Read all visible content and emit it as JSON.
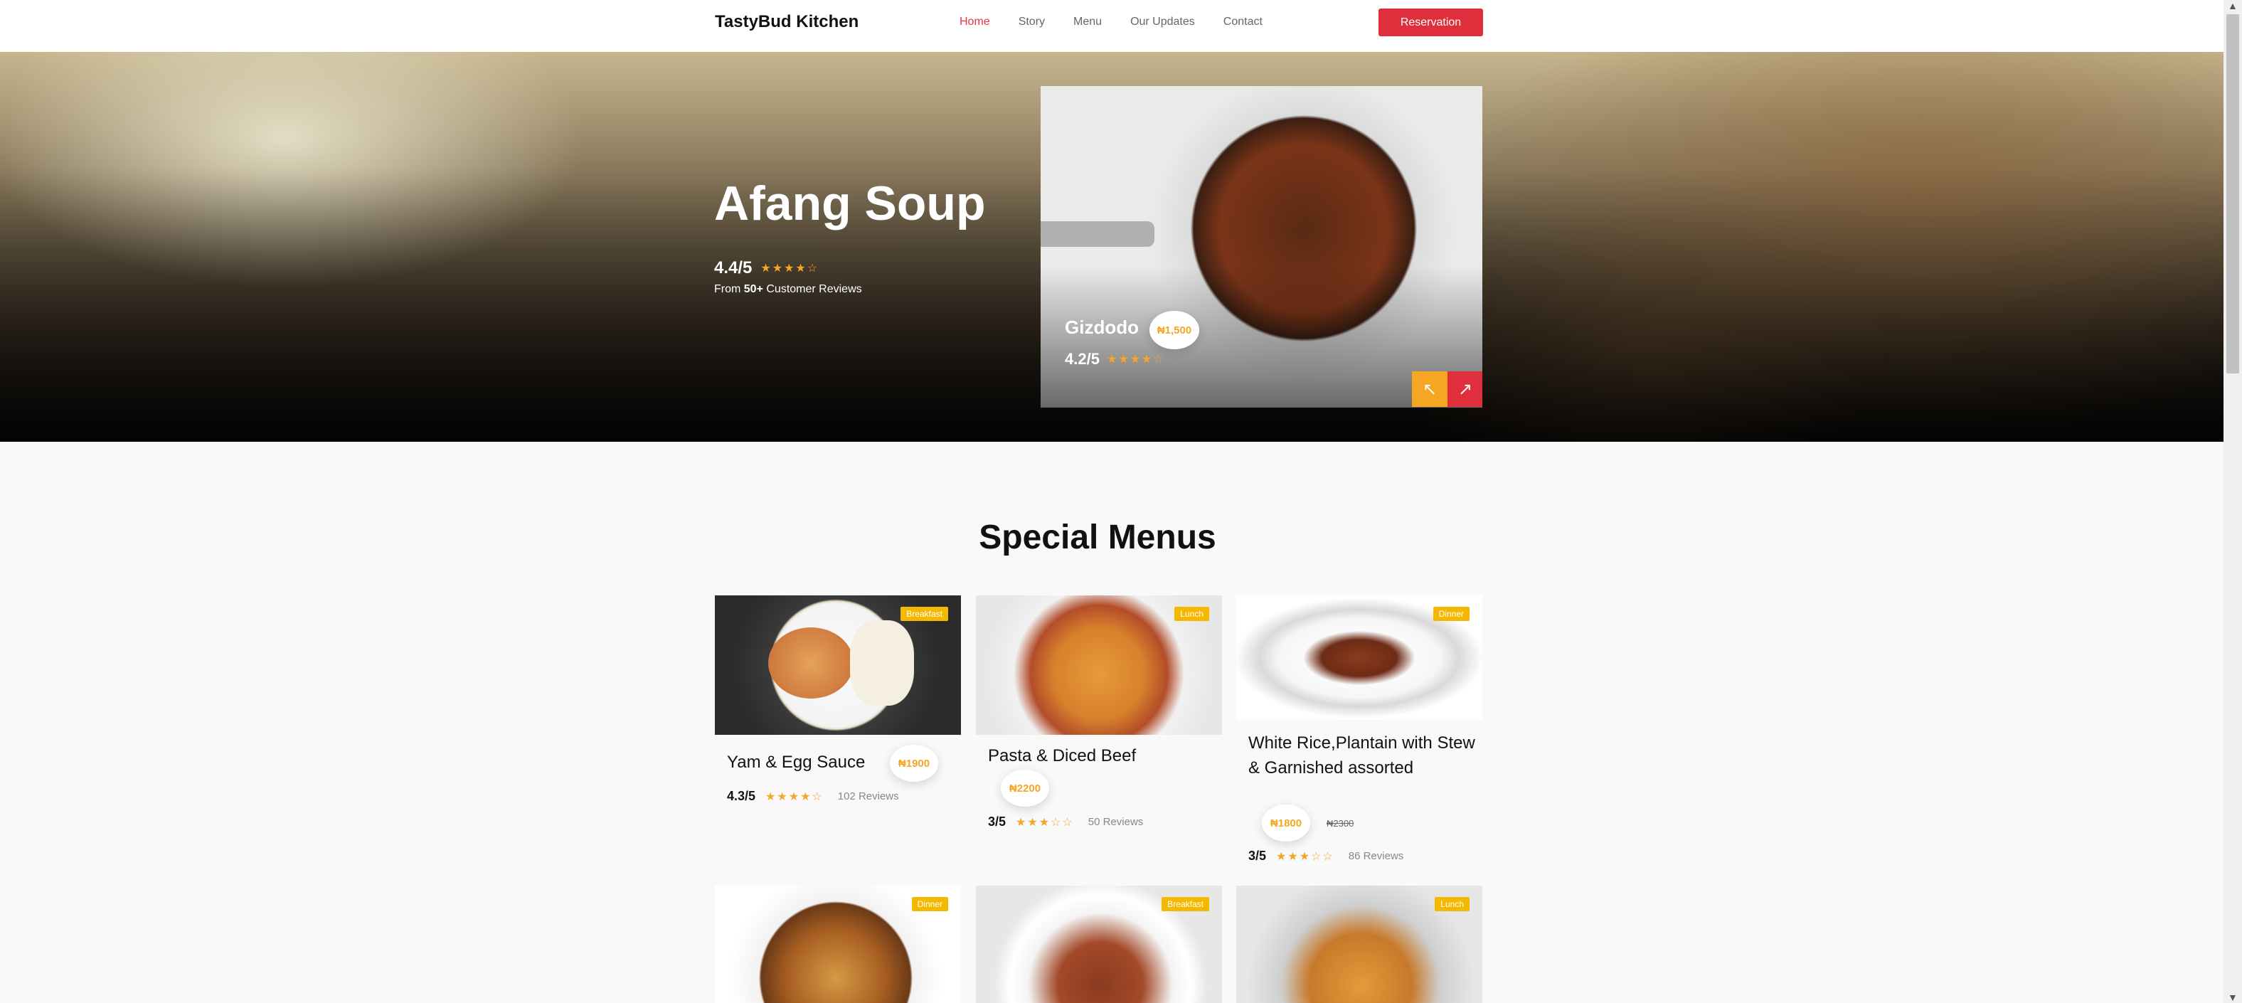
{
  "nav": {
    "brand": "TastyBud Kitchen",
    "links": [
      "Home",
      "Story",
      "Menu",
      "Our Updates",
      "Contact"
    ],
    "cta": "Reservation"
  },
  "hero": {
    "title": "Afang Soup",
    "rating": "4.4/5",
    "stars": "★★★★☆",
    "reviews_prefix": "From ",
    "reviews_count": "50+",
    "reviews_suffix": " Customer Reviews",
    "feature": {
      "name": "Gizdodo",
      "price": "₦1,500",
      "rating": "4.2/5",
      "stars": "★★★★☆"
    }
  },
  "special": {
    "title": "Special Menus",
    "items": [
      {
        "badge": "Breakfast",
        "name": "Yam & Egg Sauce",
        "price": "₦1900",
        "rating": "4.3/5",
        "stars": "★★★★☆",
        "reviews": "102 Reviews"
      },
      {
        "badge": "Lunch",
        "name": "Pasta & Diced Beef",
        "price": "₦2200",
        "rating": "3/5",
        "stars": "★★★☆☆",
        "reviews": "50 Reviews"
      },
      {
        "badge": "Dinner",
        "name": "White Rice,Plantain with Stew & Garnished assorted",
        "price": "₦1800",
        "old_price": "₦2300",
        "rating": "3/5",
        "stars": "★★★☆☆",
        "reviews": "86 Reviews"
      },
      {
        "badge": "Dinner"
      },
      {
        "badge": "Breakfast"
      },
      {
        "badge": "Lunch"
      }
    ]
  },
  "colors": {
    "accent": "#e02f3c",
    "gold": "#f5a623",
    "badge": "#f5b800"
  }
}
